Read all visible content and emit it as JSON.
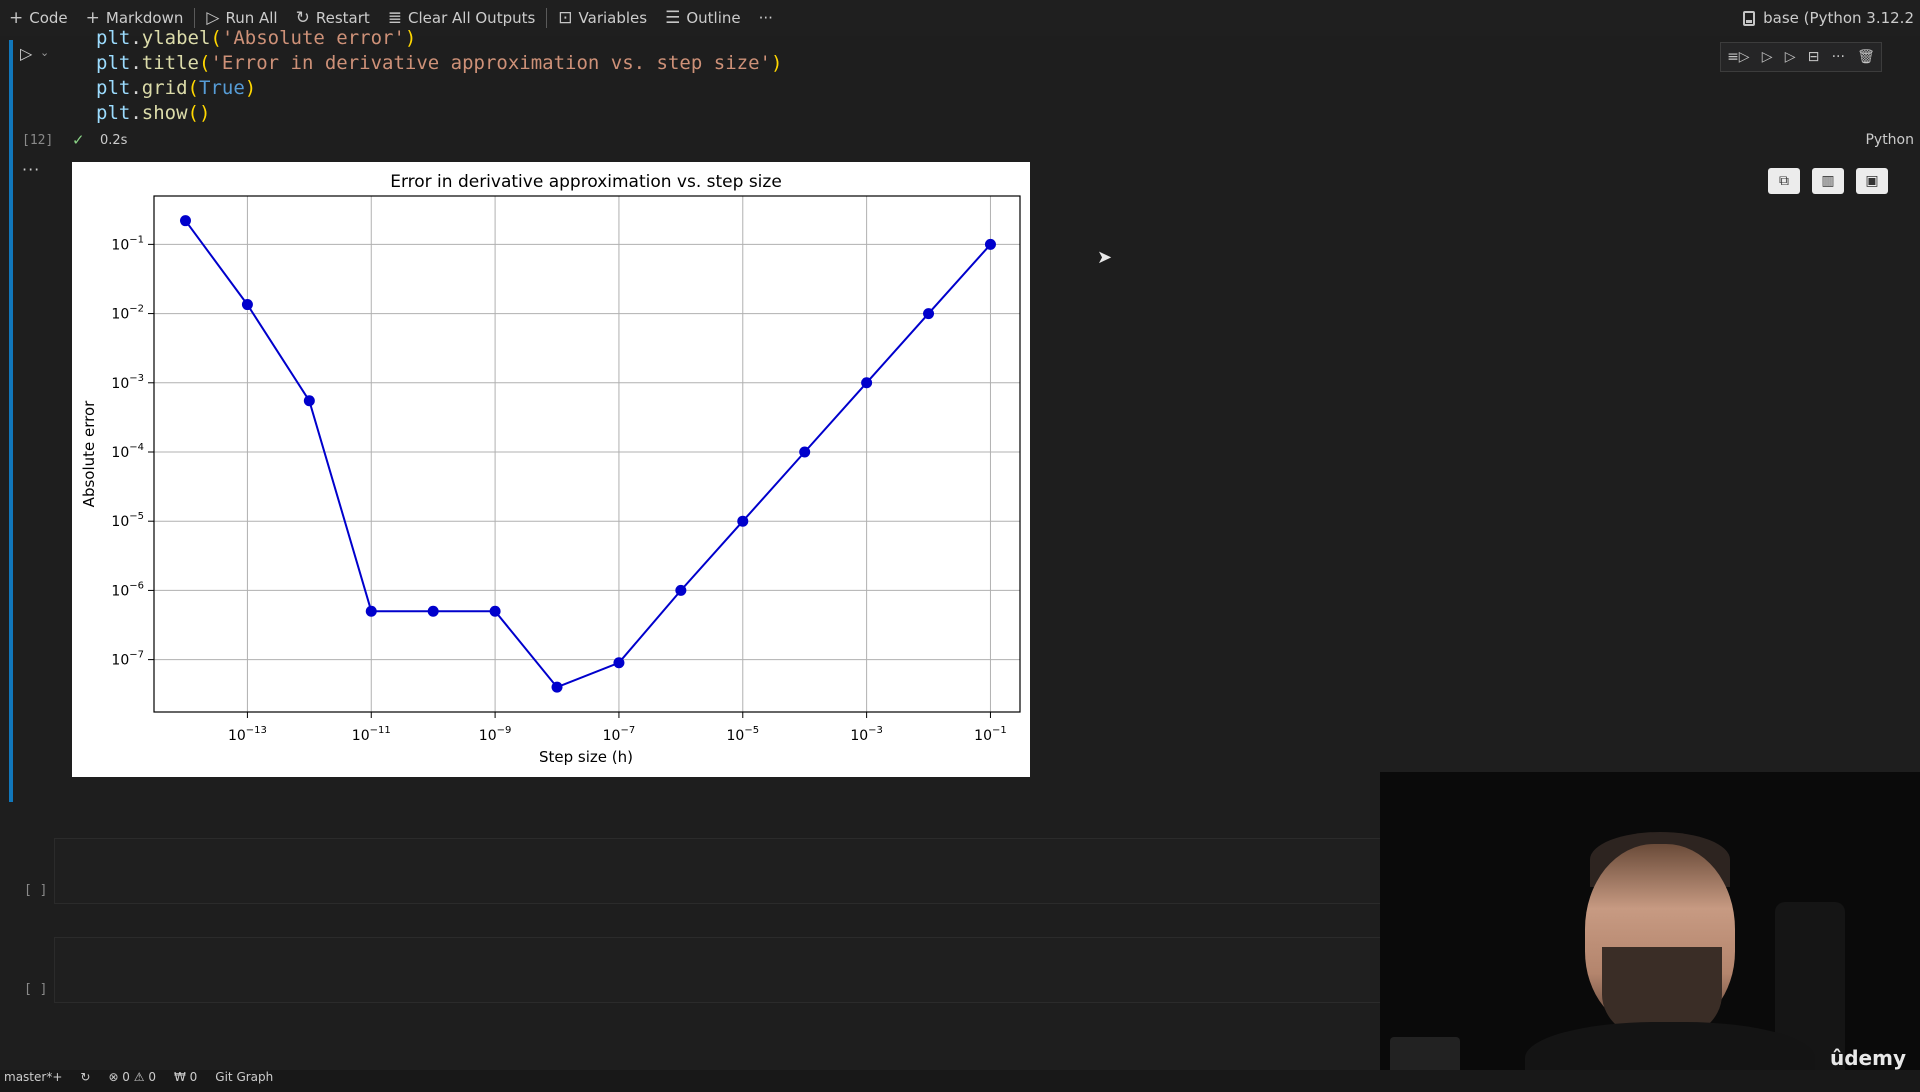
{
  "toolbar": {
    "items": [
      {
        "icon": "plus-icon",
        "label": "Code"
      },
      {
        "icon": "plus-icon",
        "label": "Markdown"
      },
      {
        "icon": "play-icon",
        "label": "Run All"
      },
      {
        "icon": "restart-icon",
        "label": "Restart"
      },
      {
        "icon": "clear-icon",
        "label": "Clear All Outputs"
      },
      {
        "icon": "variables-icon",
        "label": "Variables"
      },
      {
        "icon": "outline-icon",
        "label": "Outline"
      }
    ],
    "more": "···",
    "kernel": "base (Python 3.12.2"
  },
  "cell": {
    "code_lines": [
      [
        "plt",
        ".",
        "ylabel",
        "(",
        "'Absolute error'",
        ")"
      ],
      [
        "plt",
        ".",
        "title",
        "(",
        "'Error in derivative approximation vs. step size'",
        ")"
      ],
      [
        "plt",
        ".",
        "grid",
        "(",
        "True",
        ")"
      ],
      [
        "plt",
        ".",
        "show",
        "(",
        "",
        ")"
      ]
    ],
    "execution_count": "[12]",
    "exec_time": "0.2s",
    "language": "Python",
    "output_ellipsis": "···"
  },
  "empty_cells": [
    {
      "count": "[ ]"
    },
    {
      "count": "[ ]"
    }
  ],
  "chart_data": {
    "type": "line",
    "title": "Error in derivative approximation vs. step size",
    "xlabel": "Step size (h)",
    "ylabel": "Absolute error",
    "xscale": "log",
    "yscale": "log",
    "grid": true,
    "series_color": "#0000cc",
    "xlim": [
      3.1e-15,
      0.3
    ],
    "ylim": [
      1.75e-08,
      0.5
    ],
    "x": [
      1e-14,
      1e-13,
      1e-12,
      1e-11,
      1e-10,
      1e-09,
      1e-08,
      1e-07,
      1e-06,
      1e-05,
      0.0001,
      0.001,
      0.01,
      0.1
    ],
    "y": [
      0.22,
      0.0135,
      0.00055,
      5e-07,
      5e-07,
      5e-07,
      4e-08,
      9e-08,
      1e-06,
      1e-05,
      0.0001,
      0.001,
      0.01,
      0.1
    ],
    "xticks": [
      {
        "value": 1e-13,
        "mantissa": "10",
        "exp": "−13"
      },
      {
        "value": 1e-11,
        "mantissa": "10",
        "exp": "−11"
      },
      {
        "value": 1e-09,
        "mantissa": "10",
        "exp": "−9"
      },
      {
        "value": 1e-07,
        "mantissa": "10",
        "exp": "−7"
      },
      {
        "value": 1e-05,
        "mantissa": "10",
        "exp": "−5"
      },
      {
        "value": 0.001,
        "mantissa": "10",
        "exp": "−3"
      },
      {
        "value": 0.1,
        "mantissa": "10",
        "exp": "−1"
      }
    ],
    "yticks": [
      {
        "value": 0.1,
        "mantissa": "10",
        "exp": "−1"
      },
      {
        "value": 0.01,
        "mantissa": "10",
        "exp": "−2"
      },
      {
        "value": 0.001,
        "mantissa": "10",
        "exp": "−3"
      },
      {
        "value": 0.0001,
        "mantissa": "10",
        "exp": "−4"
      },
      {
        "value": 1e-05,
        "mantissa": "10",
        "exp": "−5"
      },
      {
        "value": 1e-06,
        "mantissa": "10",
        "exp": "−6"
      },
      {
        "value": 1e-07,
        "mantissa": "10",
        "exp": "−7"
      }
    ]
  },
  "webcam": {
    "watermark": "ûdemy"
  },
  "status": {
    "branch": "master*+",
    "problems": "⊗ 0 ⚠ 0",
    "ports": "₩ 0",
    "git_graph": "Git Graph"
  }
}
